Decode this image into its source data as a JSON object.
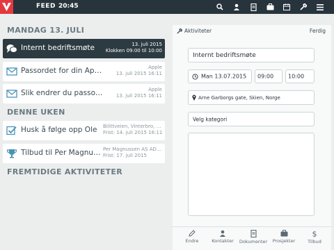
{
  "topbar": {
    "title": "FEED",
    "time": "20:45"
  },
  "sections": {
    "today": "MANDAG 13. JULI",
    "week": "DENNE UKEN",
    "future": "FREMTIDIGE AKTIVITETER"
  },
  "items": [
    {
      "title": "Internt bedriftsmøte",
      "meta1": "13. juli 2015",
      "meta2": "Klokken 09:00 til 10:00",
      "icon": "chat-bubbles-icon"
    },
    {
      "title": "Passordet for din Appl...",
      "meta1": "Apple",
      "meta2": "13. juli 2015 16:11",
      "icon": "envelope-icon"
    },
    {
      "title": "Slik endrer du passord...",
      "meta1": "Apple",
      "meta2": "13. juli 2015 16:11",
      "icon": "envelope-icon"
    },
    {
      "title": "Husk å følge opp Ole",
      "meta1": "Bilittveien, Vinterbro, Nor...",
      "meta2": "Frist: 14. juli 2015 16:11",
      "icon": "checkbox-icon"
    },
    {
      "title": "Tilbud til Per Magnuss...",
      "meta1": "Per Magnussen AS ADM,...",
      "meta2": "Frist: 17. juli 2015",
      "icon": "trophy-icon"
    }
  ],
  "detail": {
    "back_label": "Aktiviteter",
    "done_label": "Ferdig",
    "title_value": "Internt bedriftsmøte",
    "date_value": "Man 13.07.2015",
    "start_time": "09:00",
    "end_time": "10:00",
    "location": "Arne Garborgs gate, Skien, Norge",
    "category_placeholder": "Velg kategori",
    "notes": ""
  },
  "tabs": [
    "Endre",
    "Kontakter",
    "Dokumenter",
    "Prosjekter",
    "Tilbud"
  ],
  "colors": {
    "accent": "#e23a3f",
    "dark": "#27343c",
    "selected": "#2c3a42",
    "background": "#eceeee"
  }
}
